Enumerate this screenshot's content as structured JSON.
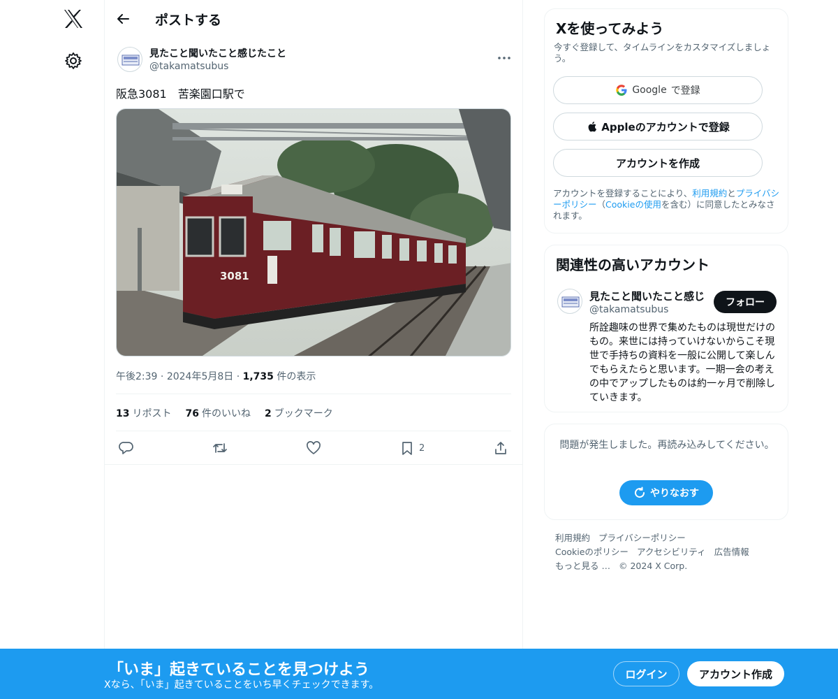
{
  "nav": {
    "logo_icon": "x-logo-icon",
    "settings_icon": "gear-icon"
  },
  "header": {
    "title": "ポストする",
    "back_icon": "arrow-left-icon"
  },
  "post": {
    "author_name": "見たこと聞いたこと感じたこと",
    "author_handle": "@takamatsubus",
    "text": "阪急3081　苦楽園口駅で",
    "time": "午後2:39",
    "dot1": "·",
    "date": "2024年5月8日",
    "dot2": "·",
    "views_count": "1,735",
    "views_label": "件の表示",
    "reposts_count": "13",
    "reposts_label": "リポスト",
    "likes_count": "76",
    "likes_label": "件のいいね",
    "bookmarks_count": "2",
    "bookmarks_label": "ブックマーク",
    "bookmark_action_count": "2",
    "photo_text": "3081"
  },
  "signup_card": {
    "title": "Xを使ってみよう",
    "subtitle": "今すぐ登録して、タイムラインをカスタマイズしましょう。",
    "google_prefix": "Google",
    "google_suffix": "で登録",
    "apple_label": "Appleのアカウントで登録",
    "create_label": "アカウントを作成",
    "legal_1": "アカウントを登録することにより、",
    "legal_terms": "利用規約",
    "legal_and": "と",
    "legal_privacy": "プライバシーポリシー",
    "legal_2": "（",
    "legal_cookie": "Cookieの使用",
    "legal_3": "を含む）に同意したとみなされます。"
  },
  "related": {
    "title": "関連性の高いアカウント",
    "name": "見たこと聞いたこと感じ",
    "handle": "@takamatsubus",
    "follow_label": "フォロー",
    "bio": "所詮趣味の世界で集めたものは現世だけのもの。来世には持っていけないからこそ現世で手持ちの資料を一般に公開して楽しんでもらえたらと思います。一期一会の考えの中でアップしたものは約一ヶ月で削除していきます。"
  },
  "error_card": {
    "message": "問題が発生しました。再読み込みしてください。",
    "retry_label": "やりなおす"
  },
  "footer": {
    "links": [
      "利用規約",
      "プライバシーポリシー",
      "Cookieのポリシー",
      "アクセシビリティ",
      "広告情報",
      "もっと見る …",
      "© 2024 X Corp."
    ]
  },
  "banner": {
    "title": "「いま」起きていることを見つけよう",
    "subtitle": "Xなら、「いま」起きていることをいち早くチェックできます。",
    "login_label": "ログイン",
    "signup_label": "アカウント作成"
  },
  "colors": {
    "accent": "#1d9bf0",
    "text": "#0f1419",
    "muted": "#536471",
    "train": "#6b1f24"
  }
}
